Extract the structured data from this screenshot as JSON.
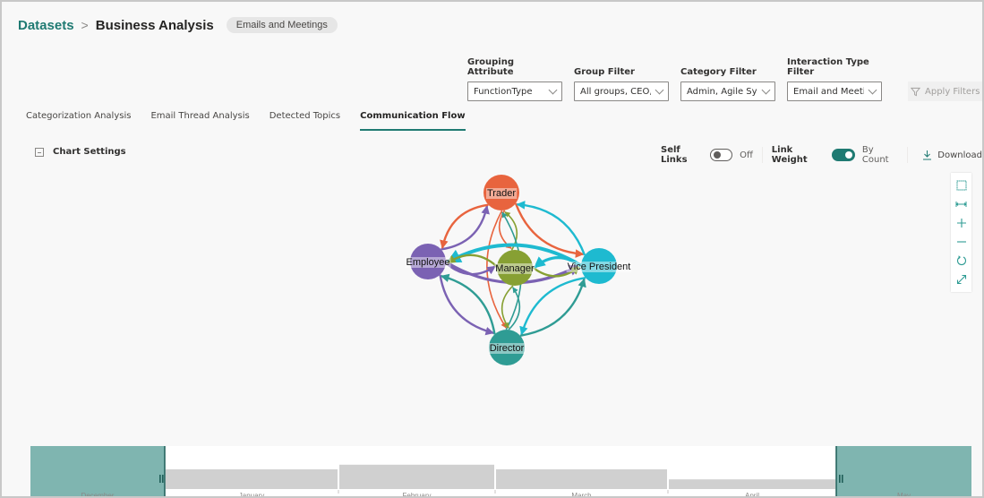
{
  "breadcrumb": {
    "root": "Datasets",
    "separator": ">",
    "current": "Business Analysis",
    "tag": "Emails and Meetings"
  },
  "filters": [
    {
      "label": "Grouping Attribute",
      "value": "FunctionType"
    },
    {
      "label": "Group Filter",
      "value": "All groups, CEO, ..."
    },
    {
      "label": "Category Filter",
      "value": "Admin, Agile Syn..."
    },
    {
      "label": "Interaction Type Filter",
      "value": "Email and Meeti..."
    }
  ],
  "apply_filters": {
    "label": "Apply Filters",
    "icon": "filter-icon",
    "enabled": false
  },
  "tabs": [
    {
      "label": "Categorization Analysis",
      "active": false
    },
    {
      "label": "Email Thread Analysis",
      "active": false
    },
    {
      "label": "Detected Topics",
      "active": false
    },
    {
      "label": "Communication Flow",
      "active": true
    }
  ],
  "chart_settings": {
    "label": "Chart Settings",
    "icon": "collapse-icon"
  },
  "controls": {
    "self_links": {
      "label": "Self Links",
      "state": "Off",
      "on": false
    },
    "link_weight": {
      "label": "Link Weight",
      "state": "By Count",
      "on": true
    },
    "download": {
      "label": "Download",
      "icon": "download-icon"
    }
  },
  "toolbar": [
    {
      "name": "select-icon",
      "title": "Select"
    },
    {
      "name": "fit-width-icon",
      "title": "Fit width"
    },
    {
      "name": "zoom-in-icon",
      "title": "Zoom in"
    },
    {
      "name": "zoom-out-icon",
      "title": "Zoom out"
    },
    {
      "name": "reset-icon",
      "title": "Reset"
    },
    {
      "name": "expand-icon",
      "title": "Expand"
    }
  ],
  "graph": {
    "nodes": [
      {
        "id": "trader",
        "label": "Trader",
        "color": "#e8643e"
      },
      {
        "id": "employee",
        "label": "Employee",
        "color": "#7b62b3"
      },
      {
        "id": "manager",
        "label": "Manager",
        "color": "#87a033"
      },
      {
        "id": "vp",
        "label": "Vice President",
        "color": "#1ebad0"
      },
      {
        "id": "director",
        "label": "Director",
        "color": "#2f9c94"
      }
    ],
    "edges": [
      {
        "from": "employee",
        "to": "trader",
        "weight": 2
      },
      {
        "from": "trader",
        "to": "employee",
        "weight": 2
      },
      {
        "from": "trader",
        "to": "vp",
        "weight": 2
      },
      {
        "from": "vp",
        "to": "trader",
        "weight": 2
      },
      {
        "from": "trader",
        "to": "manager",
        "weight": 1
      },
      {
        "from": "manager",
        "to": "trader",
        "weight": 1
      },
      {
        "from": "director",
        "to": "trader",
        "weight": 1
      },
      {
        "from": "trader",
        "to": "director",
        "weight": 1
      },
      {
        "from": "employee",
        "to": "vp",
        "weight": 3
      },
      {
        "from": "vp",
        "to": "employee",
        "weight": 4
      },
      {
        "from": "employee",
        "to": "manager",
        "weight": 2
      },
      {
        "from": "manager",
        "to": "employee",
        "weight": 2
      },
      {
        "from": "manager",
        "to": "vp",
        "weight": 2
      },
      {
        "from": "vp",
        "to": "manager",
        "weight": 3
      },
      {
        "from": "employee",
        "to": "director",
        "weight": 2
      },
      {
        "from": "director",
        "to": "employee",
        "weight": 2
      },
      {
        "from": "manager",
        "to": "director",
        "weight": 1
      },
      {
        "from": "director",
        "to": "manager",
        "weight": 1
      },
      {
        "from": "vp",
        "to": "director",
        "weight": 2
      },
      {
        "from": "director",
        "to": "vp",
        "weight": 2
      }
    ]
  },
  "timeline": {
    "months": [
      {
        "label": "December",
        "value": 0,
        "selected": false
      },
      {
        "label": "January",
        "value": 0.55,
        "selected": true
      },
      {
        "label": "February",
        "value": 0.68,
        "selected": true
      },
      {
        "label": "March",
        "value": 0.55,
        "selected": true
      },
      {
        "label": "April",
        "value": 0.27,
        "selected": true
      },
      {
        "label": "May",
        "value": 0,
        "selected": false
      }
    ],
    "selection_color": "#7fb5b0",
    "handle_color": "#1f5e58"
  }
}
